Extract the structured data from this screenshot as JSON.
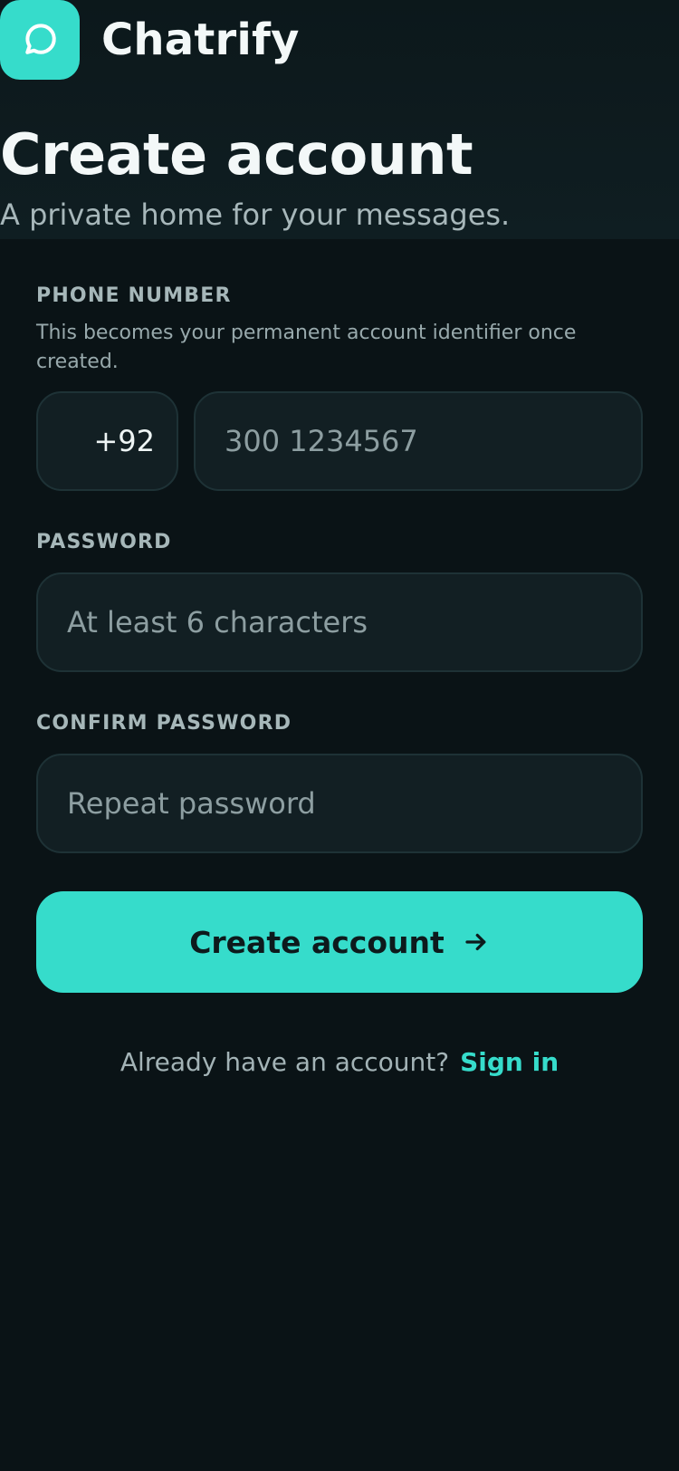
{
  "brand": {
    "name": "Chatrify",
    "icon": "chat-bubble-icon",
    "accent_color": "#36dccb"
  },
  "header": {
    "title": "Create account",
    "subtitle": "A private home for your messages."
  },
  "form": {
    "phone": {
      "label": "PHONE NUMBER",
      "hint": "This becomes your permanent account identifier once created.",
      "country_code": "+92",
      "placeholder": "300 1234567"
    },
    "password": {
      "label": "PASSWORD",
      "placeholder": "At least 6 characters"
    },
    "confirm_password": {
      "label": "CONFIRM PASSWORD",
      "placeholder": "Repeat password"
    },
    "submit": {
      "label": "Create account",
      "icon": "arrow-right-icon"
    }
  },
  "footer": {
    "prompt": "Already have an account?",
    "link": "Sign in"
  }
}
